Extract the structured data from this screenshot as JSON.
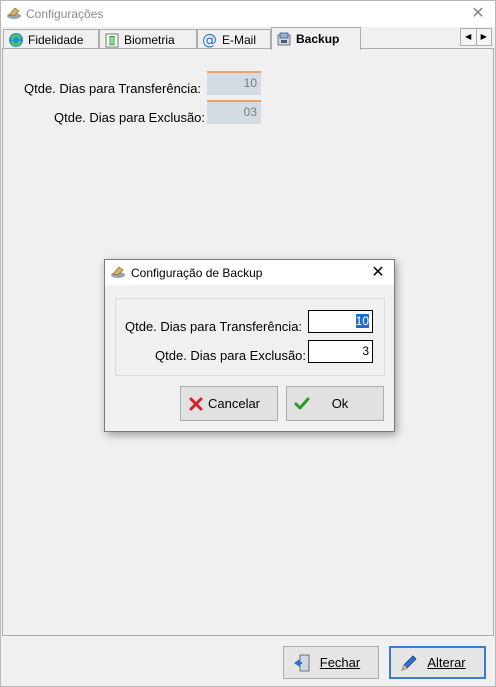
{
  "window": {
    "title": "Configurações",
    "close_glyph": "✕"
  },
  "tabs": [
    {
      "label": "Fidelidade",
      "icon": "refresh-green-icon"
    },
    {
      "label": "Biometria",
      "icon": "fingerprint-icon"
    },
    {
      "label": "E-Mail",
      "icon": "at-sign-icon"
    },
    {
      "label": "Backup",
      "icon": "backup-icon",
      "active": true
    }
  ],
  "tab_scroll": {
    "left": "◀",
    "right": "▶"
  },
  "main": {
    "transfer_label": "Qtde. Dias para Transferência:",
    "transfer_value": "10",
    "delete_label": "Qtde. Dias para Exclusão:",
    "delete_value": "03"
  },
  "dialog": {
    "title": "Configuração de Backup",
    "close_glyph": "✕",
    "transfer_label": "Qtde. Dias para Transferência:",
    "transfer_value": "10",
    "delete_label": "Qtde. Dias para Exclusão:",
    "delete_value": "3",
    "cancel_label": "Cancelar",
    "ok_label": "Ok"
  },
  "footer": {
    "close_label": "Fechar",
    "edit_label": "Alterar"
  },
  "colors": {
    "accent": "#3a7bd5",
    "selection": "#1b6fcc",
    "cancel_red": "#d4202a",
    "ok_green": "#2a9a2a"
  }
}
